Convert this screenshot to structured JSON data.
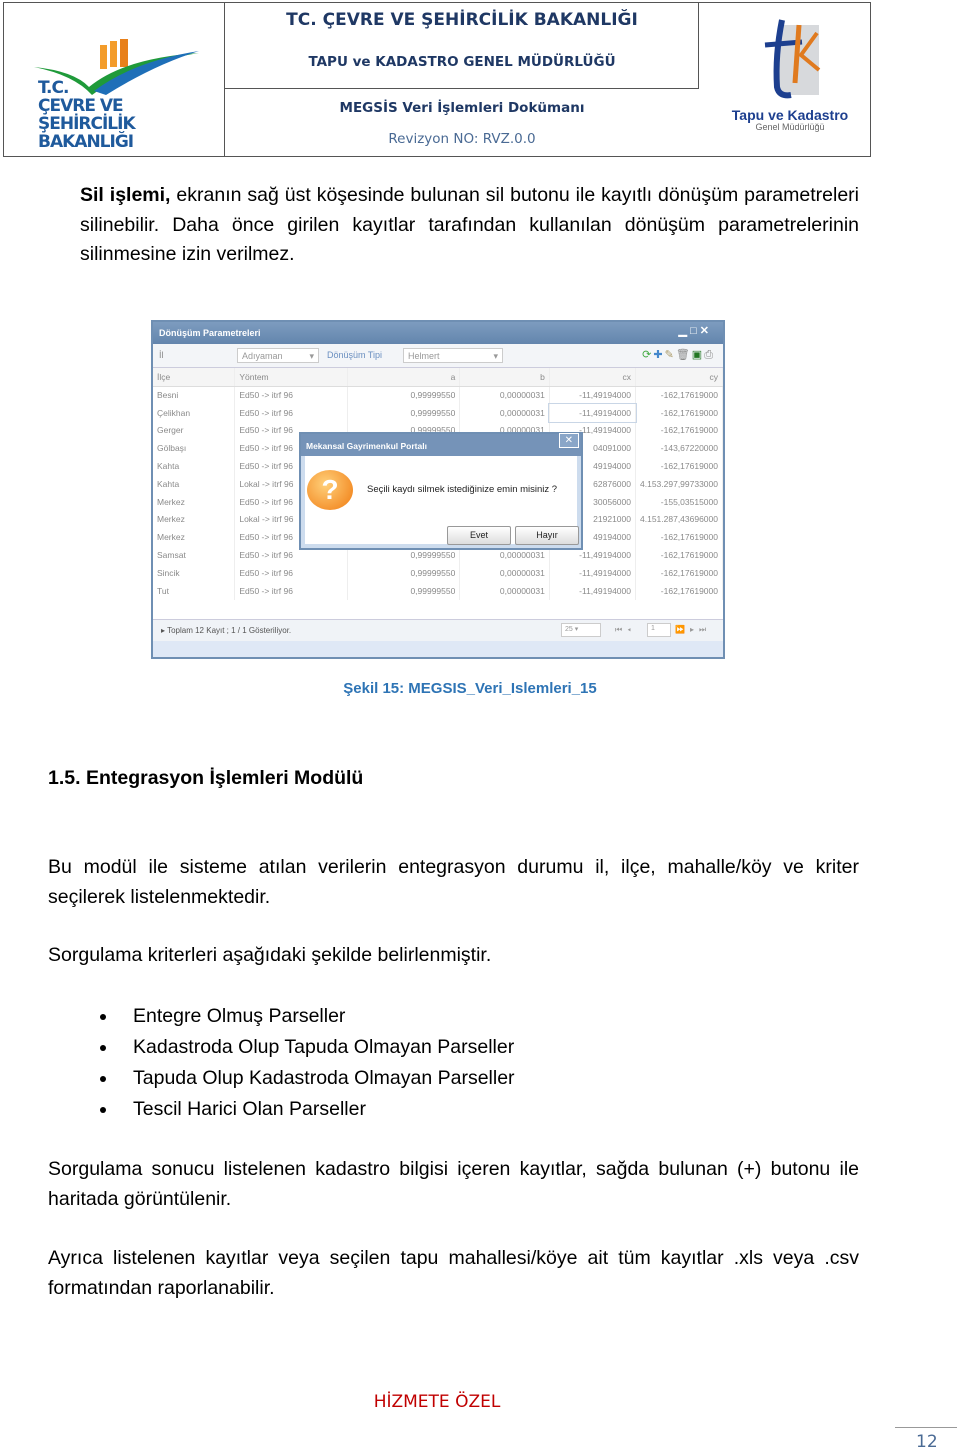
{
  "header": {
    "ministry": "TC. ÇEVRE VE ŞEHİRCİLİK BAKANLIĞI",
    "directorate": "TAPU ve KADASTRO GENEL MÜDÜRLÜĞÜ",
    "doc_title": "MEGSİS Veri İşlemleri Dokümanı",
    "revision": "Revizyon NO: RVZ.0.0",
    "logo_left_text": "T.C. ÇEVRE VE ŞEHİRCİLİK BAKANLIĞI",
    "logo_right_text": "Tapu ve Kadastro",
    "logo_right_sub": "Genel Müdürlüğü"
  },
  "intro": {
    "bold": "Sil işlemi,",
    "text": " ekranın sağ üst köşesinde bulunan sil butonu ile kayıtlı dönüşüm parametreleri silinebilir. Daha önce girilen kayıtlar tarafından kullanılan dönüşüm parametrelerinin silinmesine izin verilmez."
  },
  "screenshot": {
    "window_title": "Dönüşüm Parametreleri",
    "il_label": "İl",
    "il_value": "Adıyaman",
    "type_label": "Dönüşüm Tipi",
    "type_value": "Helmert",
    "columns": [
      "İlçe",
      "Yöntem",
      "a",
      "b",
      "cx",
      "cy"
    ],
    "rows": [
      [
        "Besni",
        "Ed50 -> itrf 96",
        "0,99999550",
        "0,00000031",
        "-11,49194000",
        "-162,17619000"
      ],
      [
        "Çelikhan",
        "Ed50 -> itrf 96",
        "0,99999550",
        "0,00000031",
        "-11,49194000",
        "-162,17619000"
      ],
      [
        "Gerger",
        "Ed50 -> itrf 96",
        "0,99999550",
        "0,00000031",
        "-11,49194000",
        "-162,17619000"
      ],
      [
        "Gölbaşı",
        "Ed50 -> itrf 96",
        "",
        "",
        "04091000",
        "-143,67220000"
      ],
      [
        "Kahta",
        "Ed50 -> itrf 96",
        "",
        "",
        "49194000",
        "-162,17619000"
      ],
      [
        "Kahta",
        "Lokal -> itrf 96",
        "",
        "",
        "62876000",
        "4.153.297,99733000"
      ],
      [
        "Merkez",
        "Ed50 -> itrf 96",
        "",
        "",
        "30056000",
        "-155,03515000"
      ],
      [
        "Merkez",
        "Lokal -> itrf 96",
        "",
        "",
        "21921000",
        "4.151.287,43696000"
      ],
      [
        "Merkez",
        "Ed50 -> itrf 96",
        "",
        "",
        "49194000",
        "-162,17619000"
      ],
      [
        "Samsat",
        "Ed50 -> itrf 96",
        "0,99999550",
        "0,00000031",
        "-11,49194000",
        "-162,17619000"
      ],
      [
        "Sincik",
        "Ed50 -> itrf 96",
        "0,99999550",
        "0,00000031",
        "-11,49194000",
        "-162,17619000"
      ],
      [
        "Tut",
        "Ed50 -> itrf 96",
        "0,99999550",
        "0,00000031",
        "-11,49194000",
        "-162,17619000"
      ]
    ],
    "footer_text": "Toplam 12 Kayıt ; 1 / 1 Gösteriliyor.",
    "page_size": "25",
    "page": "1",
    "dialog": {
      "title": "Mekansal Gayrimenkul Portalı",
      "message": "Seçili kaydı silmek istediğinize emin misiniz ?",
      "yes": "Evet",
      "no": "Hayır"
    }
  },
  "caption": "Şekil 15: MEGSIS_Veri_Islemleri_15",
  "section": {
    "number": "1.5.",
    "title": "Entegrasyon İşlemleri Modülü"
  },
  "para1": "Bu modül ile sisteme atılan verilerin entegrasyon durumu il, ilçe, mahalle/köy ve kriter seçilerek listelenmektedir.",
  "para2": "Sorgulama kriterleri aşağıdaki şekilde belirlenmiştir.",
  "bullets": [
    "Entegre Olmuş Parseller",
    "Kadastroda Olup Tapuda Olmayan Parseller",
    "Tapuda Olup Kadastroda Olmayan Parseller",
    "Tescil Harici Olan Parseller"
  ],
  "para3": "Sorgulama sonucu listelenen kadastro bilgisi içeren kayıtlar, sağda bulunan (+) butonu ile haritada görüntülenir.",
  "para4": "Ayrıca listelenen kayıtlar veya seçilen tapu mahallesi/köye ait tüm kayıtlar .xls veya .csv formatından raporlanabilir.",
  "footer": {
    "classification": "HİZMETE ÖZEL",
    "page_number": "12"
  },
  "colors": {
    "header_text": "#1f3864",
    "caption": "#2e74b5",
    "classification": "#c00000"
  }
}
